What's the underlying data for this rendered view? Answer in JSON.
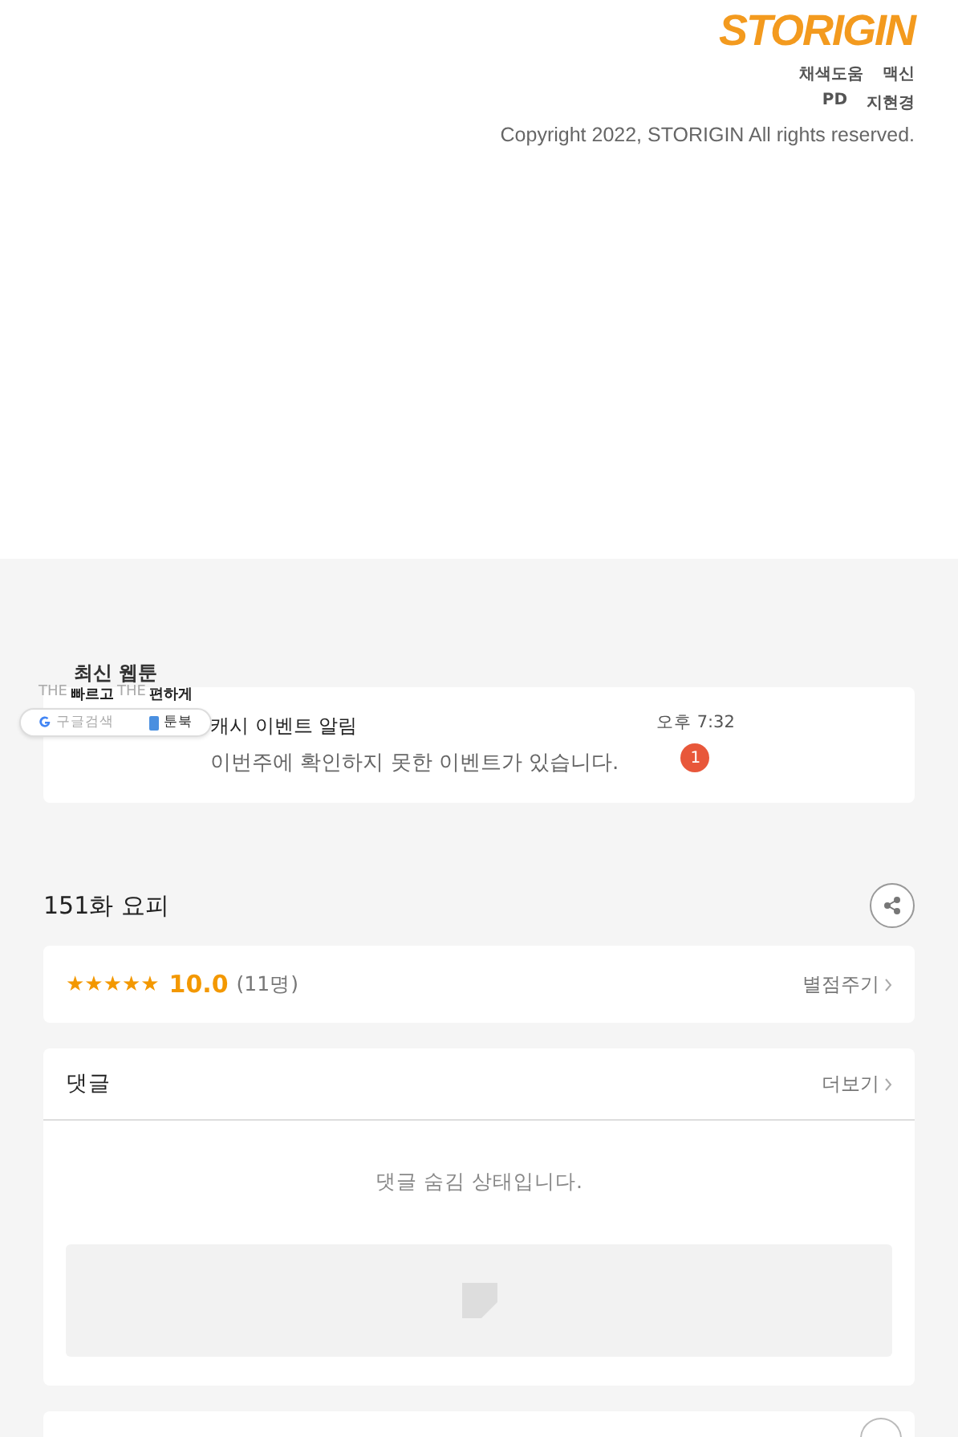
{
  "footer": {
    "logo": "STORIGIN",
    "credits": [
      {
        "role": "채색도움",
        "name": "맥신"
      },
      {
        "role": "PD",
        "name": "지현경"
      }
    ],
    "copyright": "Copyright 2022, STORIGIN All rights reserved."
  },
  "notification": {
    "title": "캐시 이벤트 알림",
    "message": "이번주에 확인하지 못한 이벤트가 있습니다.",
    "time": "오후 7:32",
    "badge": "1"
  },
  "promo": {
    "title": "최신 웹툰",
    "tagline": [
      {
        "text": "THE",
        "strong": false
      },
      {
        "text": "빠르고",
        "strong": true
      },
      {
        "text": "THE",
        "strong": false
      },
      {
        "text": "편하게",
        "strong": true
      }
    ],
    "links": [
      {
        "kind": "google",
        "label": "구글검색"
      },
      {
        "kind": "book",
        "label": "툰북"
      }
    ]
  },
  "episode": {
    "title": "151화 요피"
  },
  "rating": {
    "stars": 5,
    "score": "10.0",
    "count": "(11명)",
    "action": "별점주기"
  },
  "comments": {
    "title": "댓글",
    "more": "더보기",
    "notice": "댓글 숨김 상태입니다."
  }
}
